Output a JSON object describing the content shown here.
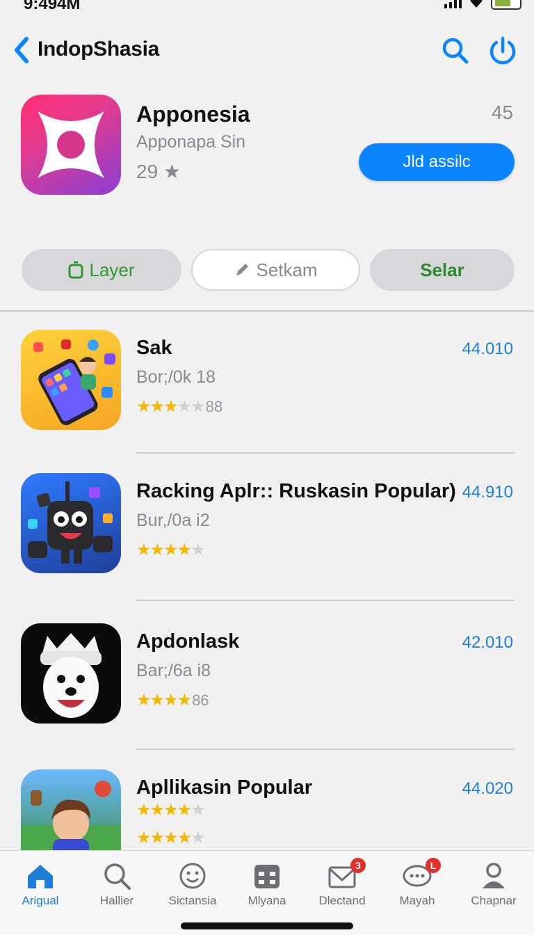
{
  "status_bar": {
    "time": "9:494M"
  },
  "nav": {
    "back_icon": "chevron-left-icon",
    "title": "IndopShasia",
    "search_icon": "search-icon",
    "power_icon": "power-icon"
  },
  "featured": {
    "title": "Apponesia",
    "subtitle": "Apponapa Sin",
    "rating": "29 ★",
    "count": "45",
    "button_label": "Jld assilc",
    "icon": "apponesia-app-icon"
  },
  "segments": [
    {
      "label": "Layer",
      "icon": "layer-icon"
    },
    {
      "label": "Setkam",
      "icon": "pencil-icon"
    },
    {
      "label": "Selar"
    }
  ],
  "apps": [
    {
      "title": "Sak",
      "subtitle": "Bor;/0k 18",
      "stars_filled": 3,
      "stars_total": 5,
      "rating_count": "88",
      "price": "44.010",
      "icon": "phone-app-icon"
    },
    {
      "title": "Racking  Aplr:: Ruskasin Popular)",
      "subtitle": "Bur,/0a i2",
      "stars_filled": 4,
      "stars_total": 5,
      "rating_count": "",
      "price": "44.910",
      "icon": "robot-app-icon"
    },
    {
      "title": "Apdonlask",
      "subtitle": "Bar;/6a i8",
      "stars_filled": 4,
      "stars_total": 4,
      "rating_count": "86",
      "price": "42.010",
      "icon": "mascot-app-icon"
    },
    {
      "title": "Apllikasin Popular",
      "subtitle": "",
      "stars_filled": 4,
      "stars_total": 5,
      "rating_count": "",
      "price": "44.020",
      "icon": "game-app-icon"
    }
  ],
  "tabs": [
    {
      "label": "Arigual",
      "icon": "home-icon",
      "active": true
    },
    {
      "label": "Hallier",
      "icon": "search-icon"
    },
    {
      "label": "Sictansia",
      "icon": "smiley-icon"
    },
    {
      "label": "Mlyana",
      "icon": "calendar-icon"
    },
    {
      "label": "Dlectand",
      "icon": "mail-icon",
      "badge": "3"
    },
    {
      "label": "Mayah",
      "icon": "chat-icon",
      "badge": "L"
    },
    {
      "label": "Chapnar",
      "icon": "person-icon"
    }
  ],
  "colors": {
    "accent": "#0a84ff",
    "link": "#1e7fd6",
    "star": "#f5b800",
    "green": "#2e9a2e",
    "badge": "#e0302a"
  }
}
